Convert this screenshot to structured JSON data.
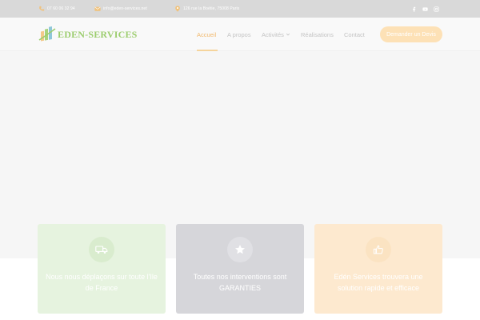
{
  "topbar": {
    "phone": "07 60 06 32 94",
    "email": "info@eden-services.net",
    "address": "126 rue la Boétie, 75008 Paris",
    "social": [
      "facebook-icon",
      "youtube-icon",
      "instagram-icon"
    ]
  },
  "header": {
    "logo_text": "EDEN-SERVICES",
    "nav": [
      {
        "label": "Accueil",
        "active": true
      },
      {
        "label": "A propos"
      },
      {
        "label": "Activités"
      },
      {
        "label": "Réalisations"
      },
      {
        "label": "Contact"
      }
    ],
    "cta_label": "Demander un Devis"
  },
  "cards": [
    {
      "icon": "truck-icon",
      "text": "Nous nous déplaçons sur toute l'Ile de France"
    },
    {
      "icon": "star-icon",
      "text": "Toutes nos interventions sont GARANTIES"
    },
    {
      "icon": "thumbs-up-icon",
      "text": "Edén Services trouvera une solution rapide et efficace"
    }
  ],
  "colors": {
    "accent": "#f1b96e",
    "brand_green": "#9ccd6e",
    "topbar": "#d9d9d9",
    "cta": "#fde1b6"
  }
}
